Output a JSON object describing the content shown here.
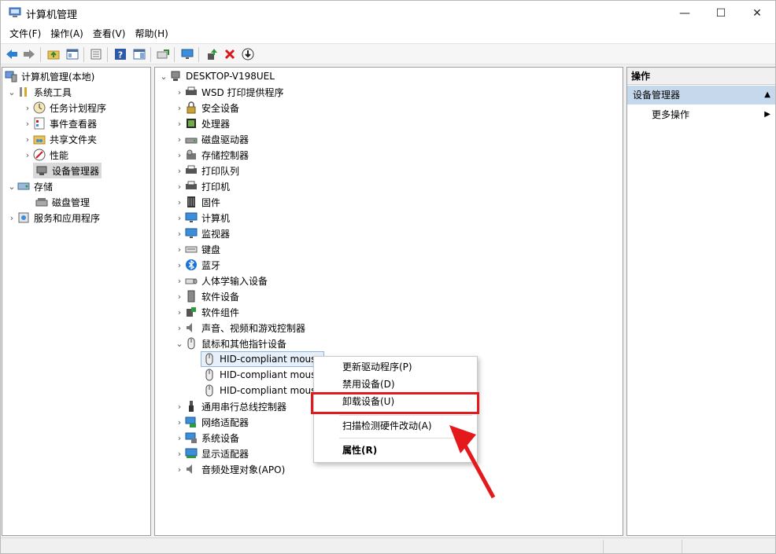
{
  "window": {
    "title": "计算机管理",
    "controls": {
      "minimize": "—",
      "maximize": "☐",
      "close": "✕"
    }
  },
  "menubar": [
    {
      "label": "文件(F)"
    },
    {
      "label": "操作(A)"
    },
    {
      "label": "查看(V)"
    },
    {
      "label": "帮助(H)"
    }
  ],
  "toolbar": [
    "back-arrow-icon",
    "forward-arrow-icon",
    "folder-up-icon",
    "show-hide-tree-icon",
    "properties-icon",
    "help-icon",
    "action-pane-icon",
    "export-icon",
    "monitor-icon",
    "update-driver-icon",
    "uninstall-icon",
    "disable-device-icon"
  ],
  "left_tree": [
    {
      "label": "计算机管理(本地)",
      "icon": "computer-management-icon"
    },
    {
      "label": "系统工具",
      "icon": "tools-icon"
    },
    {
      "label": "任务计划程序",
      "icon": "clock-icon"
    },
    {
      "label": "事件查看器",
      "icon": "event-viewer-icon"
    },
    {
      "label": "共享文件夹",
      "icon": "shared-folder-icon"
    },
    {
      "label": "性能",
      "icon": "performance-icon"
    },
    {
      "label": "设备管理器",
      "icon": "device-manager-icon"
    },
    {
      "label": "存储",
      "icon": "storage-icon"
    },
    {
      "label": "磁盘管理",
      "icon": "disk-management-icon"
    },
    {
      "label": "服务和应用程序",
      "icon": "services-icon"
    }
  ],
  "device_tree": {
    "root": "DESKTOP-V198UEL",
    "categories": [
      {
        "label": "WSD 打印提供程序"
      },
      {
        "label": "安全设备"
      },
      {
        "label": "处理器"
      },
      {
        "label": "磁盘驱动器"
      },
      {
        "label": "存储控制器"
      },
      {
        "label": "打印队列"
      },
      {
        "label": "打印机"
      },
      {
        "label": "固件"
      },
      {
        "label": "计算机"
      },
      {
        "label": "监视器"
      },
      {
        "label": "键盘"
      },
      {
        "label": "蓝牙"
      },
      {
        "label": "人体学输入设备"
      },
      {
        "label": "软件设备"
      },
      {
        "label": "软件组件"
      },
      {
        "label": "声音、视频和游戏控制器"
      },
      {
        "label": "鼠标和其他指针设备"
      },
      {
        "label": "通用串行总线控制器"
      },
      {
        "label": "网络适配器"
      },
      {
        "label": "系统设备"
      },
      {
        "label": "显示适配器"
      },
      {
        "label": "音频处理对象(APO)"
      }
    ],
    "mouse_children": [
      {
        "label": "HID-compliant mous"
      },
      {
        "label": "HID-compliant mous"
      },
      {
        "label": "HID-compliant mous"
      }
    ]
  },
  "actions_pane": {
    "header": "操作",
    "section": "设备管理器",
    "item": "更多操作"
  },
  "context_menu": [
    {
      "label": "更新驱动程序(P)"
    },
    {
      "label": "禁用设备(D)"
    },
    {
      "label": "卸载设备(U)"
    },
    {
      "label": "扫描检测硬件改动(A)"
    },
    {
      "label": "属性(R)"
    }
  ],
  "colors": {
    "highlight_red": "#e3191c",
    "selection_blue": "#c5d8ec",
    "window_bg": "#f0f0f0"
  }
}
